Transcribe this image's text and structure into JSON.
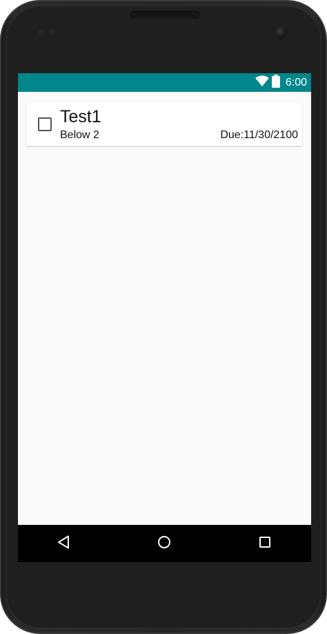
{
  "status_bar": {
    "time": "6:00",
    "wifi_icon": "wifi-icon",
    "battery_icon": "battery-icon",
    "color": "#00868b"
  },
  "tasks": [
    {
      "title": "Test1",
      "subtitle": "Below 2",
      "due": "Due:11/30/2100",
      "checked": false
    }
  ],
  "nav": {
    "back_icon": "back-triangle-icon",
    "home_icon": "home-circle-icon",
    "recents_icon": "recents-square-icon"
  }
}
